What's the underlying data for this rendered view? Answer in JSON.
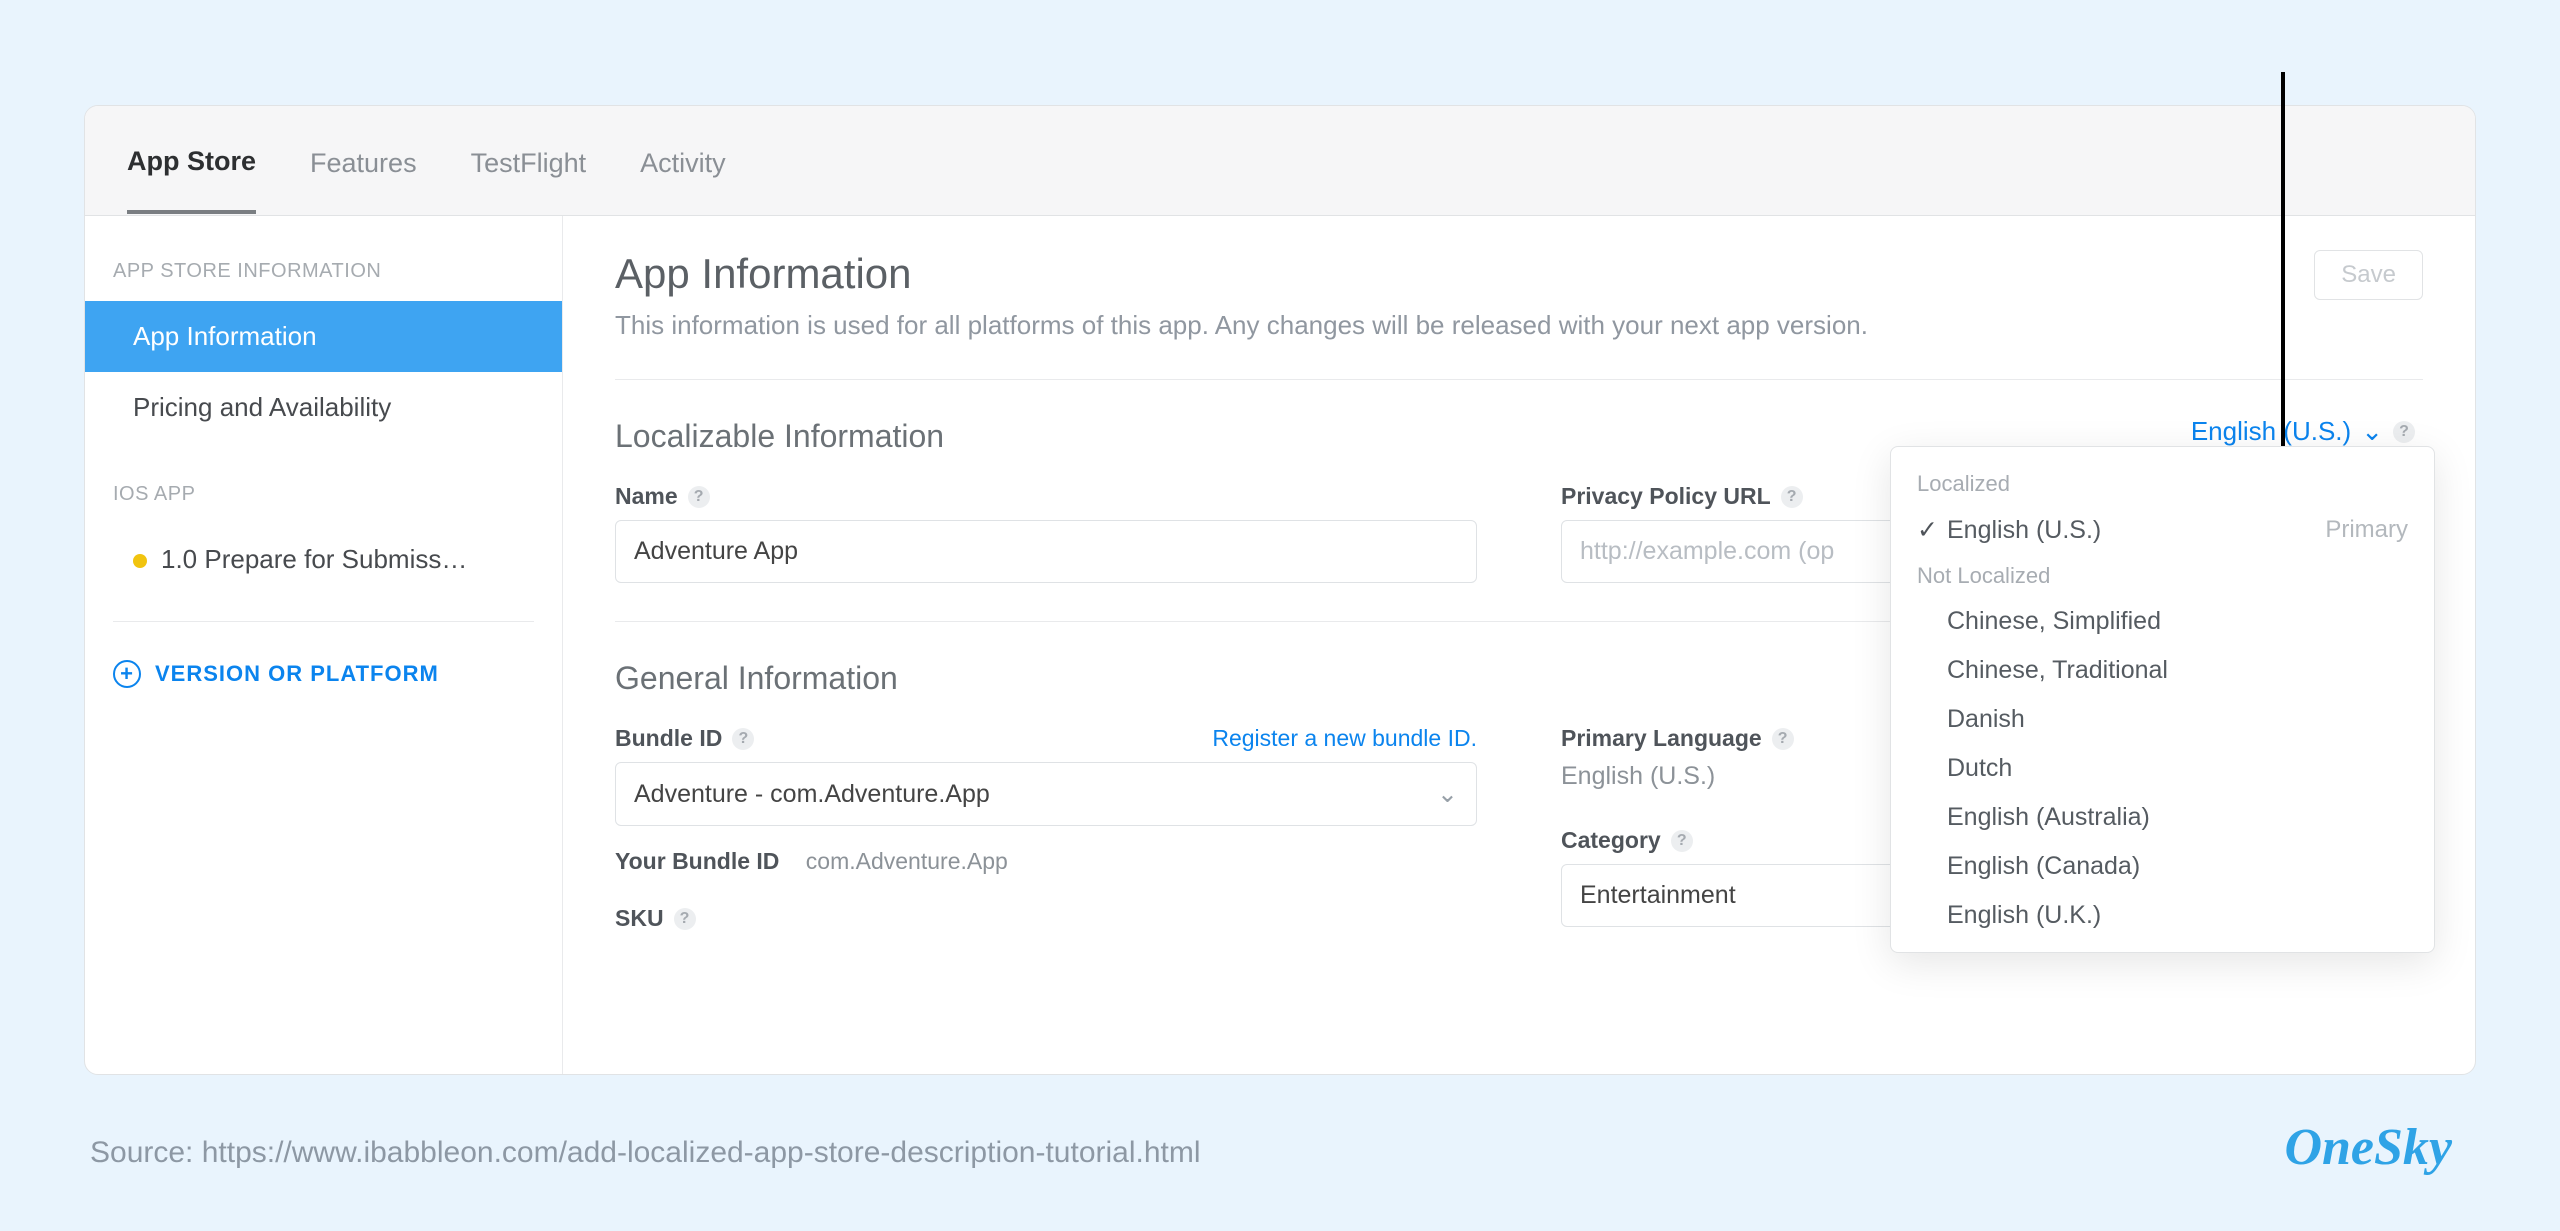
{
  "tabs": [
    "App Store",
    "Features",
    "TestFlight",
    "Activity"
  ],
  "sidebar": {
    "section1_head": "APP STORE INFORMATION",
    "items1": [
      "App Information",
      "Pricing and Availability"
    ],
    "section2_head": "iOS APP",
    "items2": [
      "1.0 Prepare for Submiss…"
    ],
    "action": "VERSION OR PLATFORM"
  },
  "header": {
    "title": "App Information",
    "subtitle": "This information is used for all platforms of this app. Any changes will be released with your next app version.",
    "save": "Save"
  },
  "localizable": {
    "title": "Localizable Information",
    "name_label": "Name",
    "name_value": "Adventure App",
    "privacy_label": "Privacy Policy URL",
    "privacy_placeholder": "http://example.com (op"
  },
  "lang_trigger": "English (U.S.)",
  "general": {
    "title": "General Information",
    "bundle_label": "Bundle ID",
    "bundle_link": "Register a new bundle ID.",
    "bundle_value": "Adventure - com.Adventure.App",
    "your_bundle_label": "Your Bundle ID",
    "your_bundle_value": "com.Adventure.App",
    "sku_label": "SKU",
    "primary_lang_label": "Primary Language",
    "primary_lang_value": "English (U.S.)",
    "category_label": "Category",
    "category_value": "Entertainment"
  },
  "popup": {
    "localized_head": "Localized",
    "localized": [
      {
        "name": "English (U.S.)",
        "primary": "Primary",
        "checked": true
      }
    ],
    "notloc_head": "Not Localized",
    "not_localized": [
      "Chinese, Simplified",
      "Chinese, Traditional",
      "Danish",
      "Dutch",
      "English (Australia)",
      "English (Canada)",
      "English (U.K.)"
    ]
  },
  "source_line": "Source: https://www.ibabbleon.com/add-localized-app-store-description-tutorial.html",
  "logo": "OneSky"
}
